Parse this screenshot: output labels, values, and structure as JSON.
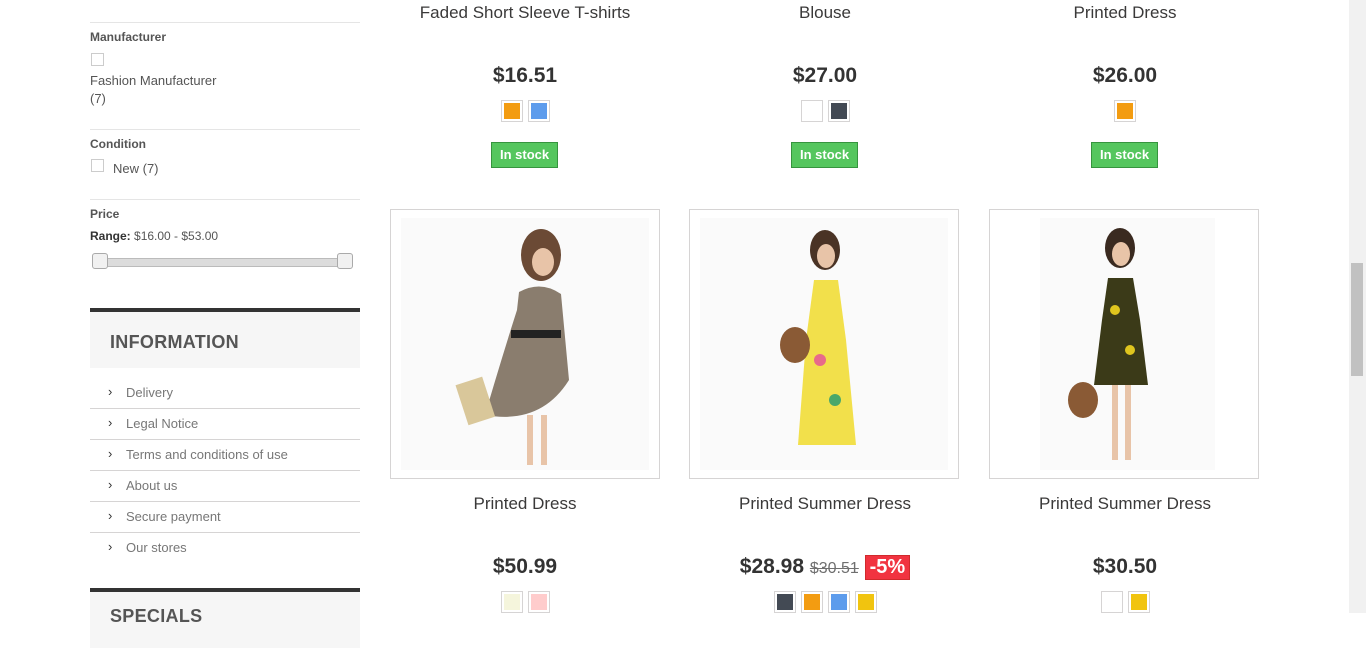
{
  "filters": {
    "manufacturer": {
      "title": "Manufacturer",
      "option": "Fashion Manufacturer",
      "count": "(7)"
    },
    "condition": {
      "title": "Condition",
      "option": "New (7)"
    },
    "price": {
      "title": "Price",
      "range_label": "Range:",
      "range_value": "$16.00 - $53.00"
    }
  },
  "information": {
    "title": "INFORMATION",
    "links": [
      "Delivery",
      "Legal Notice",
      "Terms and conditions of use",
      "About us",
      "Secure payment",
      "Our stores"
    ]
  },
  "specials": {
    "title": "SPECIALS"
  },
  "products_top": [
    {
      "name": "Faded Short Sleeve T-shirts",
      "price": "$16.51",
      "colors": [
        "#f39c11",
        "#5d9cec"
      ],
      "stock": "In stock"
    },
    {
      "name": "Blouse",
      "price": "$27.00",
      "colors": [
        "#ffffff",
        "#434a54"
      ],
      "stock": "In stock"
    },
    {
      "name": "Printed Dress",
      "price": "$26.00",
      "colors": [
        "#f39c11"
      ],
      "stock": "In stock"
    }
  ],
  "products_bottom": [
    {
      "name": "Printed Dress",
      "price": "$50.99",
      "colors": [
        "#f5f5dc",
        "#fcc"
      ]
    },
    {
      "name": "Printed Summer Dress",
      "price": "$28.98",
      "old_price": "$30.51",
      "discount": "-5%",
      "colors": [
        "#434a54",
        "#f39c11",
        "#5d9cec",
        "#f1c40f"
      ]
    },
    {
      "name": "Printed Summer Dress",
      "price": "$30.50",
      "colors": [
        "#ffffff",
        "#f1c40f"
      ]
    }
  ],
  "icons": {
    "list_chevron": "›"
  }
}
